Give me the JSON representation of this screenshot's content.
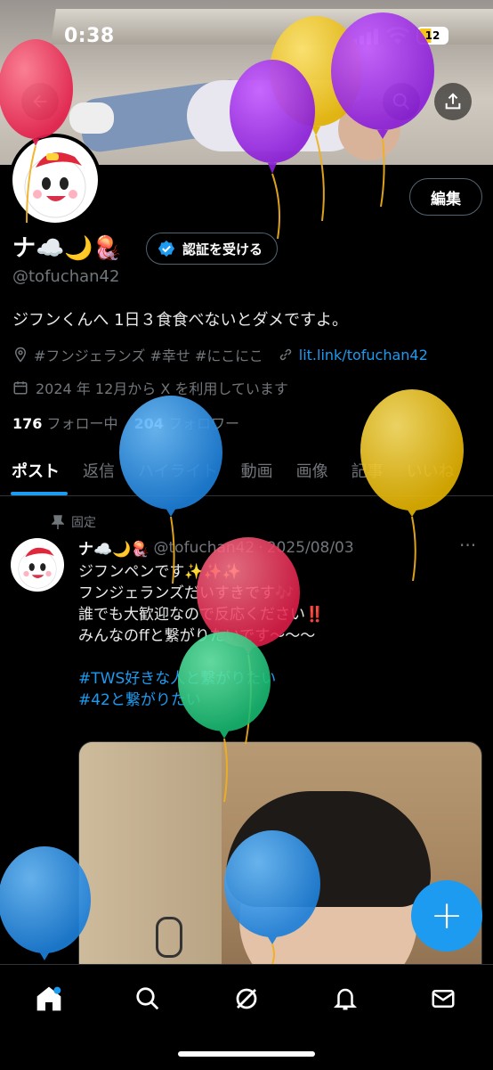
{
  "status_bar": {
    "time": "0:38",
    "battery": "12"
  },
  "profile": {
    "display_name": "ナ☁️🌙🪼",
    "handle": "@tofuchan42",
    "bio": "ジフンくんへ 1日３食食べないとダメですよ。",
    "edit_label": "編集",
    "verify_label": "認証を受ける",
    "location": "#フンジェランズ #幸せ #にこにこ",
    "link": "lit.link/tofuchan42",
    "joined": "2024 年 12月から X を利用しています",
    "following_count": "176",
    "following_label": "フォロー中",
    "followers_count": "204",
    "followers_label": "フォロワー"
  },
  "tabs": [
    "ポスト",
    "返信",
    "ハイライト",
    "動画",
    "画像",
    "記事",
    "いいね"
  ],
  "post": {
    "pinned_label": "固定",
    "name": "ナ☁️🌙🪼",
    "handle": "@tofuchan42",
    "separator": "·",
    "date": "2025/08/03",
    "more": "···",
    "lines": [
      "ジフンペンです✨✨✨",
      "フンジェランズだいすきです🎶",
      "誰でも大歓迎なので反応ください‼️",
      "みんなのffと繋がりたいです〜〜〜"
    ],
    "hashtags": [
      "#TWS好きな人と繋がりたい",
      "#42と繋がりたい"
    ]
  },
  "fab_label": "+",
  "colors": {
    "accent": "#1d9bf0",
    "background": "#000000",
    "muted": "#71767b"
  },
  "icons": {
    "back": "arrow-left-icon",
    "search": "search-icon",
    "share": "share-icon",
    "verified": "verified-badge-icon",
    "location": "location-pin-icon",
    "link": "link-icon",
    "calendar": "calendar-icon",
    "pin": "pin-icon",
    "nav": [
      "home-icon",
      "search-icon",
      "grok-icon",
      "bell-icon",
      "mail-icon"
    ]
  }
}
